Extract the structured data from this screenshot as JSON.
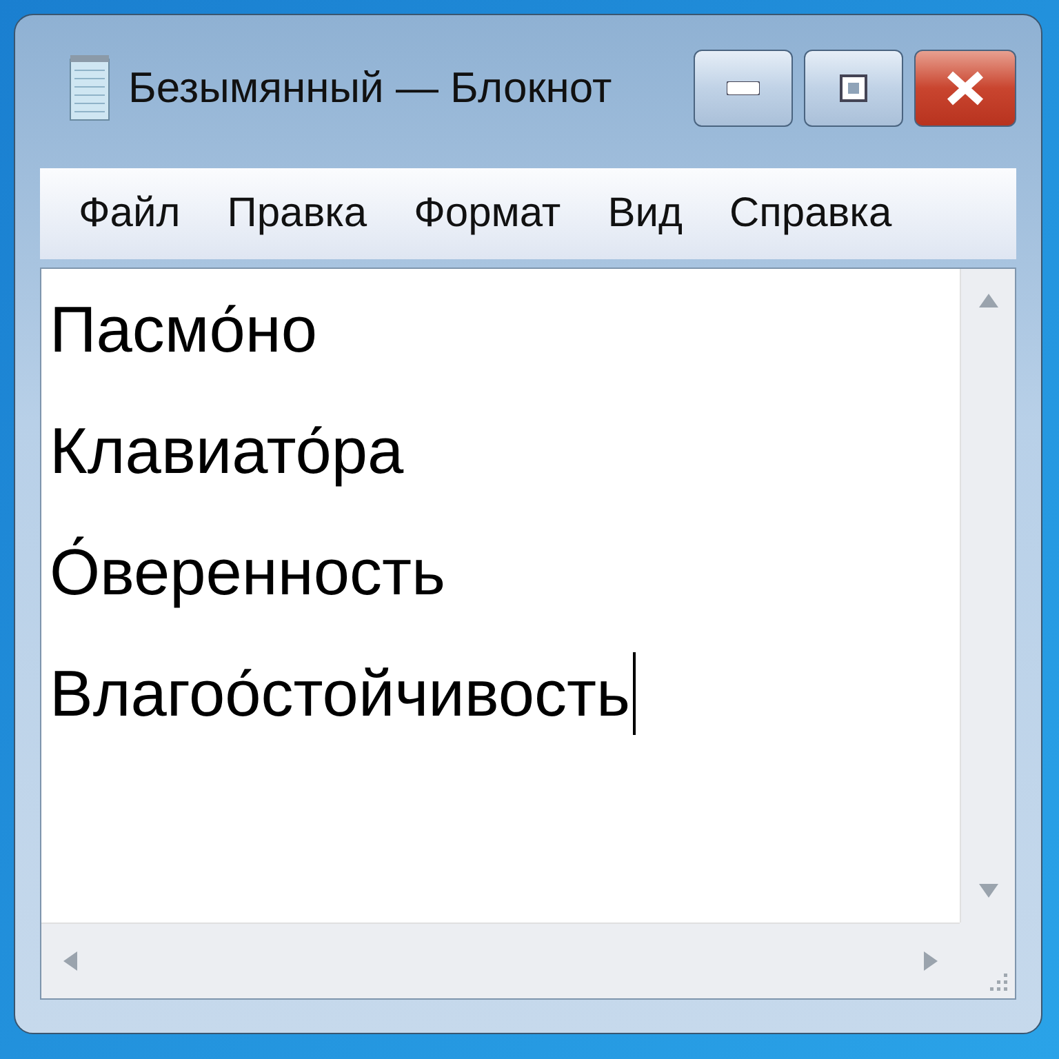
{
  "window": {
    "title": "Безымянный — Блокнот"
  },
  "menu": [
    {
      "label": "Файл"
    },
    {
      "label": "Правка"
    },
    {
      "label": "Формат"
    },
    {
      "label": "Вид"
    },
    {
      "label": "Справка"
    }
  ],
  "editor": {
    "lines": [
      "Пасмо́но",
      "Клавиато́ра",
      "О́веренность",
      "Влагоо́стойчивость"
    ]
  }
}
